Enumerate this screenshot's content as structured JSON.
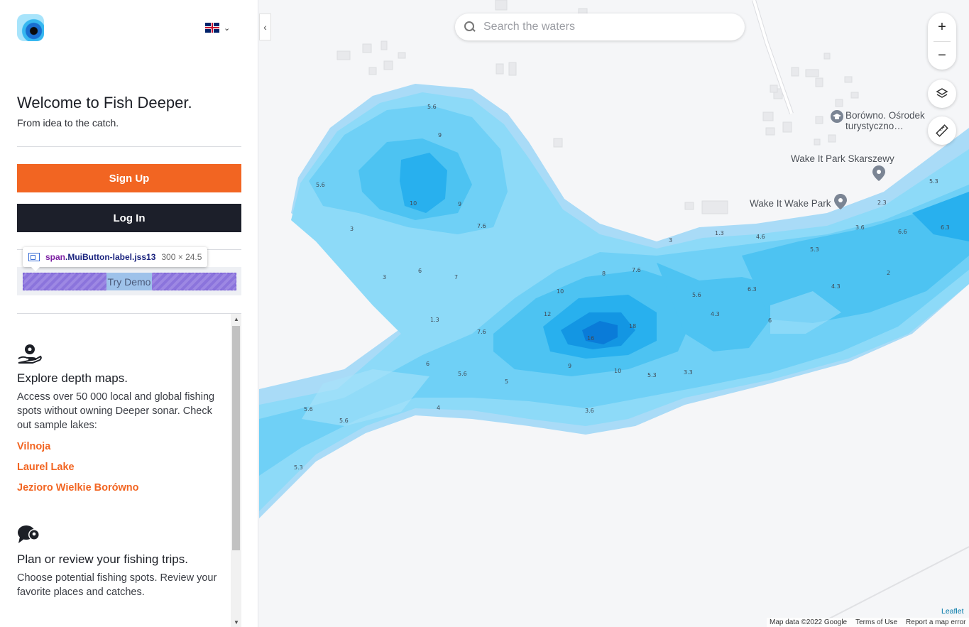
{
  "sidebar": {
    "welcome_title": "Welcome to Fish Deeper.",
    "welcome_subtitle": "From idea to the catch.",
    "signup_label": "Sign Up",
    "login_label": "Log In",
    "try_demo_label": "Try Demo",
    "devtools_tooltip": {
      "element": "span",
      "class_name": ".MuiButton-label.jss13",
      "size": "300 × 24.5"
    },
    "features": [
      {
        "icon": "map-pin-hand-icon",
        "title": "Explore depth maps.",
        "text": "Access over 50 000 local and global fishing spots without owning Deeper sonar. Check out sample lakes:",
        "links": [
          "Vilnoja",
          "Laurel Lake",
          "Jezioro Wielkie Borówno"
        ]
      },
      {
        "icon": "chat-pin-icon",
        "title": "Plan or review your fishing trips.",
        "text": "Choose potential fishing spots. Review your favorite places and catches."
      }
    ],
    "colors": {
      "accent": "#f26522",
      "login": "#1c1f2a"
    }
  },
  "map": {
    "search_placeholder": "Search the waters",
    "zoom_in": "+",
    "zoom_out": "−",
    "pois": [
      {
        "name": "Borówno. Ośrodek",
        "line2": "turystyczno…"
      },
      {
        "name": "Wake It Park Skarszewy"
      },
      {
        "name": "Wake It Wake Park"
      }
    ],
    "depth_labels": [
      "5.6",
      "9",
      "10",
      "9",
      "5.6",
      "3",
      "7.6",
      "3",
      "6",
      "7",
      "1.3",
      "7.6",
      "8",
      "7.6",
      "10",
      "12",
      "16",
      "18",
      "9",
      "10",
      "6",
      "5.6",
      "5",
      "4",
      "5.6",
      "5.6",
      "5.3",
      "3.6",
      "5.3",
      "3.3",
      "3",
      "1.3",
      "4.6",
      "5.3",
      "5.6",
      "4.3",
      "6.3",
      "6",
      "4.3",
      "3.6",
      "6.6",
      "2.3",
      "5.3",
      "6.3",
      "2"
    ],
    "attribution": {
      "data": "Map data ©2022 Google",
      "terms": "Terms of Use",
      "report": "Report a map error",
      "leaflet": "Leaflet"
    },
    "colors": {
      "water_edge": "#a9dbf7",
      "water": "#6fd0f6",
      "deep": "#1ba4ec",
      "deepest": "#0a7bd8"
    }
  }
}
